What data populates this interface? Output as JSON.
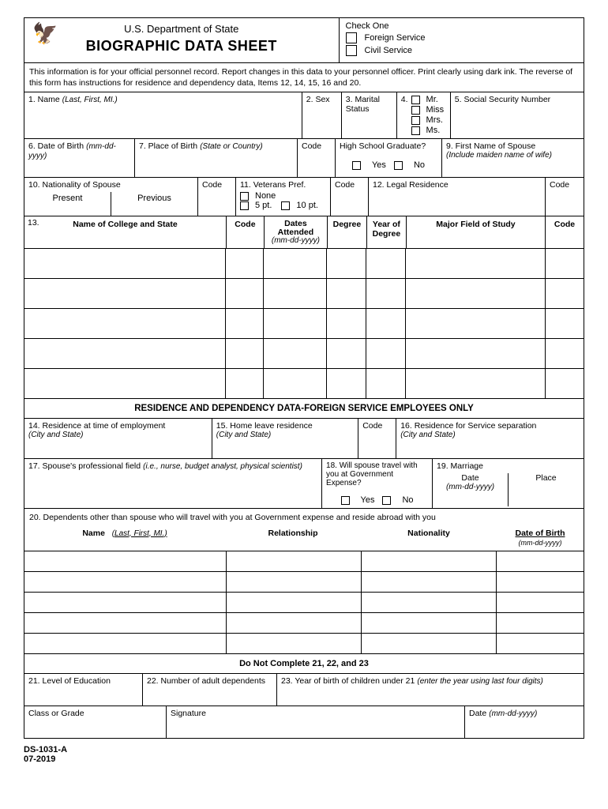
{
  "header": {
    "dept": "U.S. Department of State",
    "title": "BIOGRAPHIC DATA SHEET",
    "check_one": "Check One",
    "opt_foreign": "Foreign Service",
    "opt_civil": "Civil Service"
  },
  "instr": "This information is for your official personnel record.  Report changes in this data to your personnel officer.  Print clearly using dark ink. The reverse of this form has instructions for residence and dependency data, Items 12, 14, 15, 16 and 20.",
  "f1": {
    "label": "1.  Name",
    "hint": "(Last, First, MI.)"
  },
  "f2": {
    "label": "2.  Sex"
  },
  "f3": {
    "label": "3. Marital Status"
  },
  "f4": {
    "label": "4.",
    "mr": "Mr.",
    "miss": "Miss",
    "mrs": "Mrs.",
    "ms": "Ms."
  },
  "f5": {
    "label": "5.  Social Security Number"
  },
  "f6": {
    "label": "6.  Date of Birth",
    "hint": "(mm-dd-yyyy)"
  },
  "f7": {
    "label": "7.  Place of Birth",
    "hint": "(State or Country)"
  },
  "code": "Code",
  "hs": {
    "label": "High School Graduate?",
    "yes": "Yes",
    "no": "No"
  },
  "f9": {
    "label": "9.  First Name of Spouse",
    "hint": "(Include maiden name of wife)"
  },
  "f10": {
    "label": "10.  Nationality of Spouse",
    "present": "Present",
    "previous": "Previous"
  },
  "f11": {
    "label": "11.  Veterans Pref.",
    "none": "None",
    "p5": "5 pt.",
    "p10": "10 pt."
  },
  "f12": {
    "label": "12.  Legal Residence"
  },
  "f13": {
    "num": "13.",
    "college": "Name of College and State",
    "dates": "Dates Attended",
    "dateshint": "(mm-dd-yyyy)",
    "degree": "Degree",
    "yeardeg": "Year of Degree",
    "major": "Major Field of Study"
  },
  "section_residence": "RESIDENCE AND DEPENDENCY DATA-FOREIGN SERVICE EMPLOYEES ONLY",
  "f14": {
    "label": "14.  Residence at time of employment",
    "hint": "(City and State)"
  },
  "f15": {
    "label": "15.  Home leave residence",
    "hint": "(City and State)"
  },
  "f16": {
    "label": "16.  Residence for Service separation",
    "hint": "(City and State)"
  },
  "f17": {
    "label": "17.  Spouse's professional field",
    "hint": "(i.e., nurse, budget analyst, physical scientist)"
  },
  "f18": {
    "label": "18.  Will spouse travel with you at Government Expense?",
    "yes": "Yes",
    "no": "No"
  },
  "f19": {
    "label": "19.  Marriage",
    "date": "Date",
    "datehint": "(mm-dd-yyyy)",
    "place": "Place"
  },
  "f20": {
    "label": "20.  Dependents other than spouse who will travel with you at Government expense and reside abroad with you",
    "name": "Name",
    "namehint": "(Last, First, MI.)",
    "rel": "Relationship",
    "nat": "Nationality",
    "dob": "Date of Birth",
    "dobhint": "(mm-dd-yyyy)"
  },
  "do_not": "Do Not Complete 21, 22, and 23",
  "f21": {
    "label": "21.  Level of Education"
  },
  "f22": {
    "label": "22.  Number of adult dependents"
  },
  "f23": {
    "label": "23.  Year of birth of children under 21",
    "hint": "(enter the year using last four digits)"
  },
  "class_grade": "Class or Grade",
  "signature": "Signature",
  "date_label": "Date",
  "date_hint": "(mm-dd-yyyy)",
  "footer": {
    "form": "DS-1031-A",
    "rev": "07-2019"
  }
}
